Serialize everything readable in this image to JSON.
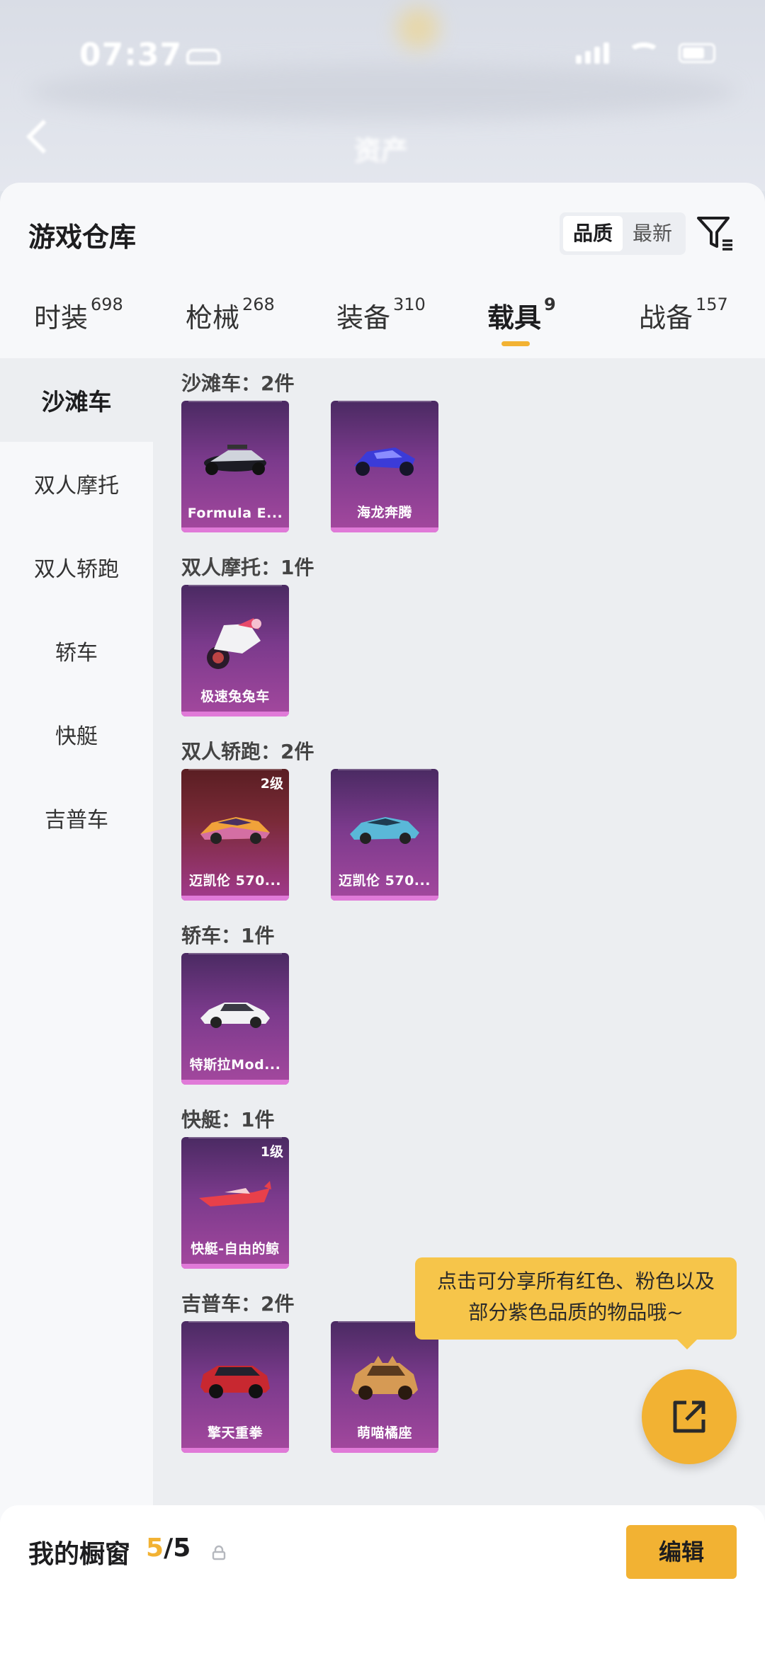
{
  "status_bar": {
    "time": "07:37"
  },
  "header": {
    "title": "资产"
  },
  "warehouse": {
    "title": "游戏仓库",
    "sort_options": [
      "品质",
      "最新"
    ],
    "sort_selected": "品质"
  },
  "tabs": [
    {
      "label": "时装",
      "count": "698"
    },
    {
      "label": "枪械",
      "count": "268"
    },
    {
      "label": "装备",
      "count": "310"
    },
    {
      "label": "载具",
      "count": "9",
      "active": true
    },
    {
      "label": "战备",
      "count": "157"
    }
  ],
  "sidebar": [
    {
      "label": "沙滩车",
      "active": true
    },
    {
      "label": "双人摩托"
    },
    {
      "label": "双人轿跑"
    },
    {
      "label": "轿车"
    },
    {
      "label": "快艇"
    },
    {
      "label": "吉普车"
    }
  ],
  "groups": [
    {
      "title": "沙滩车：2件",
      "items": [
        {
          "name": "Formula E...",
          "level": ""
        },
        {
          "name": "海龙奔腾",
          "level": ""
        }
      ]
    },
    {
      "title": "双人摩托：1件",
      "items": [
        {
          "name": "极速兔兔车",
          "level": ""
        }
      ]
    },
    {
      "title": "双人轿跑：2件",
      "items": [
        {
          "name": "迈凯伦 570...",
          "level": "2级"
        },
        {
          "name": "迈凯伦 570...",
          "level": ""
        }
      ]
    },
    {
      "title": "轿车：1件",
      "items": [
        {
          "name": "特斯拉Mod...",
          "level": ""
        }
      ]
    },
    {
      "title": "快艇：1件",
      "items": [
        {
          "name": "快艇-自由的鲸",
          "level": "1级"
        }
      ]
    },
    {
      "title": "吉普车：2件",
      "items": [
        {
          "name": "擎天重拳",
          "level": ""
        },
        {
          "name": "萌喵橘座",
          "level": ""
        }
      ]
    }
  ],
  "tooltip": {
    "line1": "点击可分享所有红色、粉色以及",
    "line2": "部分紫色品质的物品哦~"
  },
  "showcase": {
    "title": "我的橱窗",
    "current": "5",
    "total": "/5",
    "edit_label": "编辑"
  },
  "colors": {
    "accent": "#f2b233",
    "card_purple": "#7b3a8c",
    "card_red": "#7a2a38"
  }
}
